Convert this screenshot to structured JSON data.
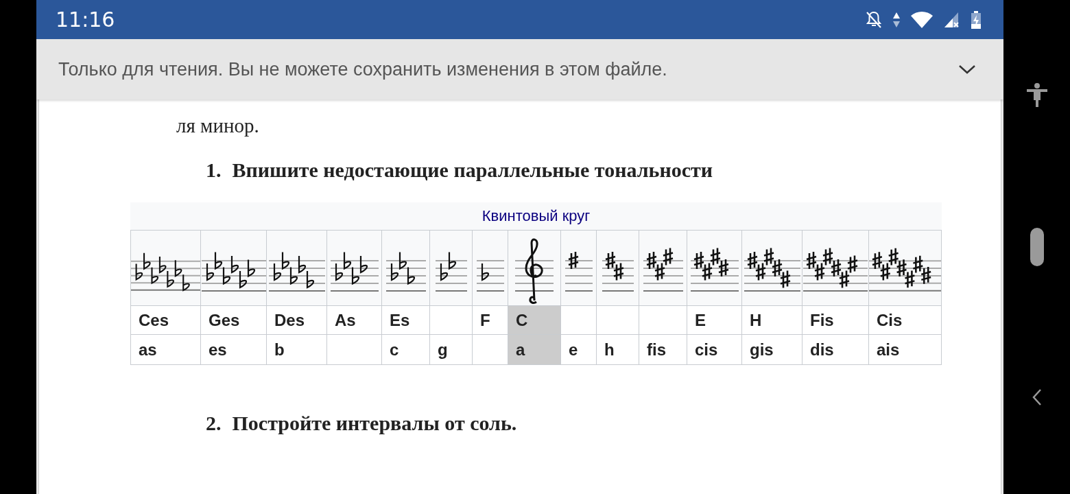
{
  "status_bar": {
    "time": "11:16"
  },
  "banner": {
    "message": "Только для чтения. Вы не можете сохранить изменения в этом файле."
  },
  "document": {
    "paragraph": {
      "text": "ля минор."
    },
    "heading_1": {
      "number": "1.",
      "text": "Впишите недостающие параллельные тональности"
    },
    "table": {
      "title": "Квинтовый круг",
      "columns": [
        {
          "kind": "flats",
          "major": "Ces",
          "minor": "as",
          "selected": false
        },
        {
          "kind": "flats",
          "major": "Ges",
          "minor": "es",
          "selected": false
        },
        {
          "kind": "flats",
          "major": "Des",
          "minor": "b",
          "selected": false
        },
        {
          "kind": "flats",
          "major": "As",
          "selected": false
        },
        {
          "kind": "flats",
          "major": "Es",
          "minor": "c",
          "selected": false
        },
        {
          "kind": "flats",
          "minor": "g",
          "selected": false
        },
        {
          "kind": "flats",
          "major": "F",
          "selected": false
        },
        {
          "kind": "clef",
          "major": "C",
          "minor": "a",
          "selected": true
        },
        {
          "kind": "sharps",
          "minor": "e",
          "selected": false
        },
        {
          "kind": "sharps",
          "minor": "h",
          "selected": false
        },
        {
          "kind": "sharps",
          "minor": "fis",
          "selected": false
        },
        {
          "kind": "sharps",
          "major": "E",
          "minor": "cis",
          "selected": false
        },
        {
          "kind": "sharps",
          "major": "H",
          "minor": "gis",
          "selected": false
        },
        {
          "kind": "sharps",
          "major": "Fis",
          "minor": "dis",
          "selected": false
        },
        {
          "kind": "sharps",
          "major": "Cis",
          "minor": "ais",
          "selected": false
        }
      ]
    },
    "heading_2": {
      "number": "2.",
      "text": "Постройте интервалы от соль."
    }
  }
}
